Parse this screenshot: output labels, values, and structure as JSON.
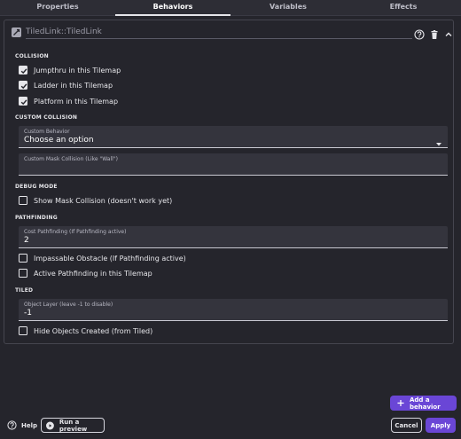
{
  "tabs": [
    "Properties",
    "Behaviors",
    "Variables",
    "Effects"
  ],
  "active_tab": "Behaviors",
  "behavior": {
    "name": "TiledLink::TiledLink"
  },
  "sections": {
    "collision": "COLLISION",
    "custom_collision": "CUSTOM COLLISION",
    "debug_mode": "DEBUG MODE",
    "pathfinding": "PATHFINDING",
    "tiled": "TILED"
  },
  "checkboxes": {
    "jumpthru": {
      "label": "Jumpthru in this Tilemap",
      "checked": true
    },
    "ladder": {
      "label": "Ladder in this Tilemap",
      "checked": true
    },
    "platform": {
      "label": "Platform in this Tilemap",
      "checked": true
    },
    "show_mask": {
      "label": "Show Mask Collision (doesn't work yet)",
      "checked": false
    },
    "impassable": {
      "label": "Impassable Obstacle (If Pathfinding active)",
      "checked": false
    },
    "active_pathfinding": {
      "label": "Active Pathfinding in this Tilemap",
      "checked": false
    },
    "hide_objects": {
      "label": "Hide Objects Created (from Tiled)",
      "checked": false
    }
  },
  "fields": {
    "custom_behavior": {
      "label": "Custom Behavior",
      "value": "Choose an option"
    },
    "custom_mask": {
      "label": "Custom Mask Collision (Like \"Wall\")",
      "value": ""
    },
    "cost_pathfinding": {
      "label": "Cost Pathfinding (If Pathfinding active)",
      "value": "2"
    },
    "object_layer": {
      "label": "Object Layer (leave -1 to disable)",
      "value": "-1"
    }
  },
  "footer": {
    "add_behavior": "Add a behavior",
    "help": "Help",
    "run_preview": "Run a preview",
    "cancel": "Cancel",
    "apply": "Apply"
  },
  "colors": {
    "accent": "#6a46d6",
    "background": "#25252c"
  }
}
